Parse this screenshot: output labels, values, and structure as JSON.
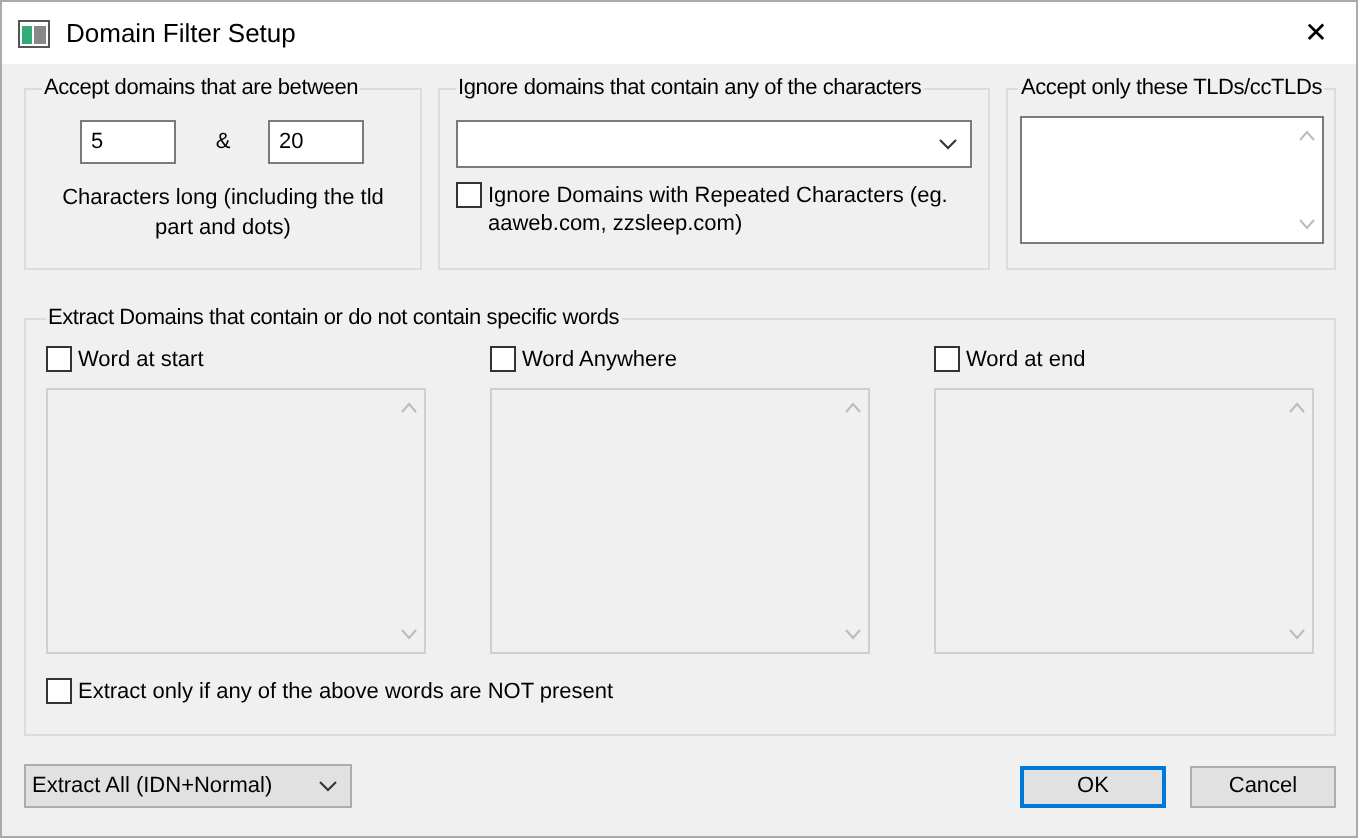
{
  "window": {
    "title": "Domain Filter Setup",
    "close": "✕"
  },
  "length_group": {
    "legend": "Accept domains that are between",
    "min": "5",
    "separator": "&",
    "max": "20",
    "note": "Characters long (including the tld part and dots)"
  },
  "ignore_group": {
    "legend": "Ignore domains that contain any of the characters",
    "repeated_checkbox": {
      "label": "Ignore Domains with Repeated Characters (eg. aaweb.com, zzsleep.com)",
      "checked": false
    }
  },
  "tld_group": {
    "legend": "Accept only these TLDs/ccTLDs"
  },
  "words_group": {
    "legend": "Extract Domains that contain or do not contain specific words",
    "columns": [
      {
        "label": "Word at start",
        "checked": false
      },
      {
        "label": "Word Anywhere",
        "checked": false
      },
      {
        "label": "Word at end",
        "checked": false
      }
    ],
    "not_present": {
      "label": "Extract only if any of the above words are NOT present",
      "checked": false
    }
  },
  "mode_select": {
    "value": "Extract All (IDN+Normal)"
  },
  "buttons": [
    {
      "label": "OK",
      "default": true
    },
    {
      "label": "Cancel",
      "default": false
    }
  ]
}
